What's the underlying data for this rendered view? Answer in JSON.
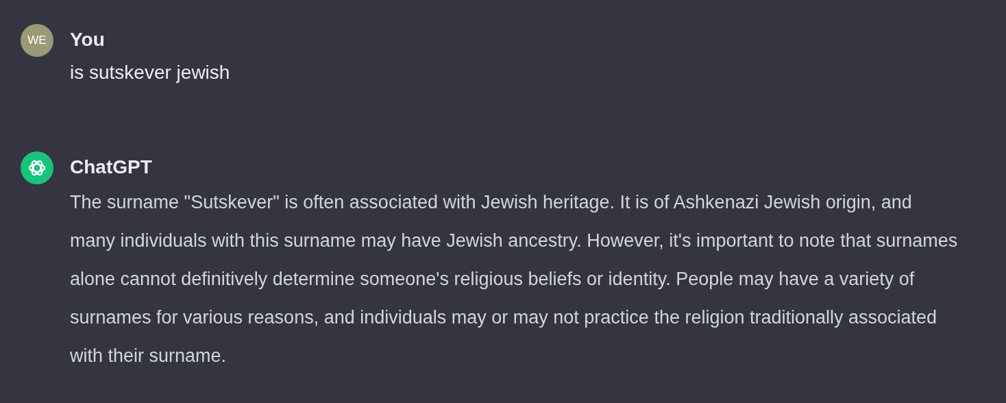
{
  "messages": [
    {
      "kind": "user",
      "author": "You",
      "avatar_text": "WE",
      "text": "is sutskever jewish"
    },
    {
      "kind": "assistant",
      "author": "ChatGPT",
      "text": "The surname \"Sutskever\" is often associated with Jewish heritage. It is of Ashkenazi Jewish origin, and many individuals with this surname may have Jewish ancestry. However, it's important to note that surnames alone cannot definitively determine someone's religious beliefs or identity. People may have a variety of surnames for various reasons, and individuals may or may not practice the religion traditionally associated with their surname."
    }
  ]
}
